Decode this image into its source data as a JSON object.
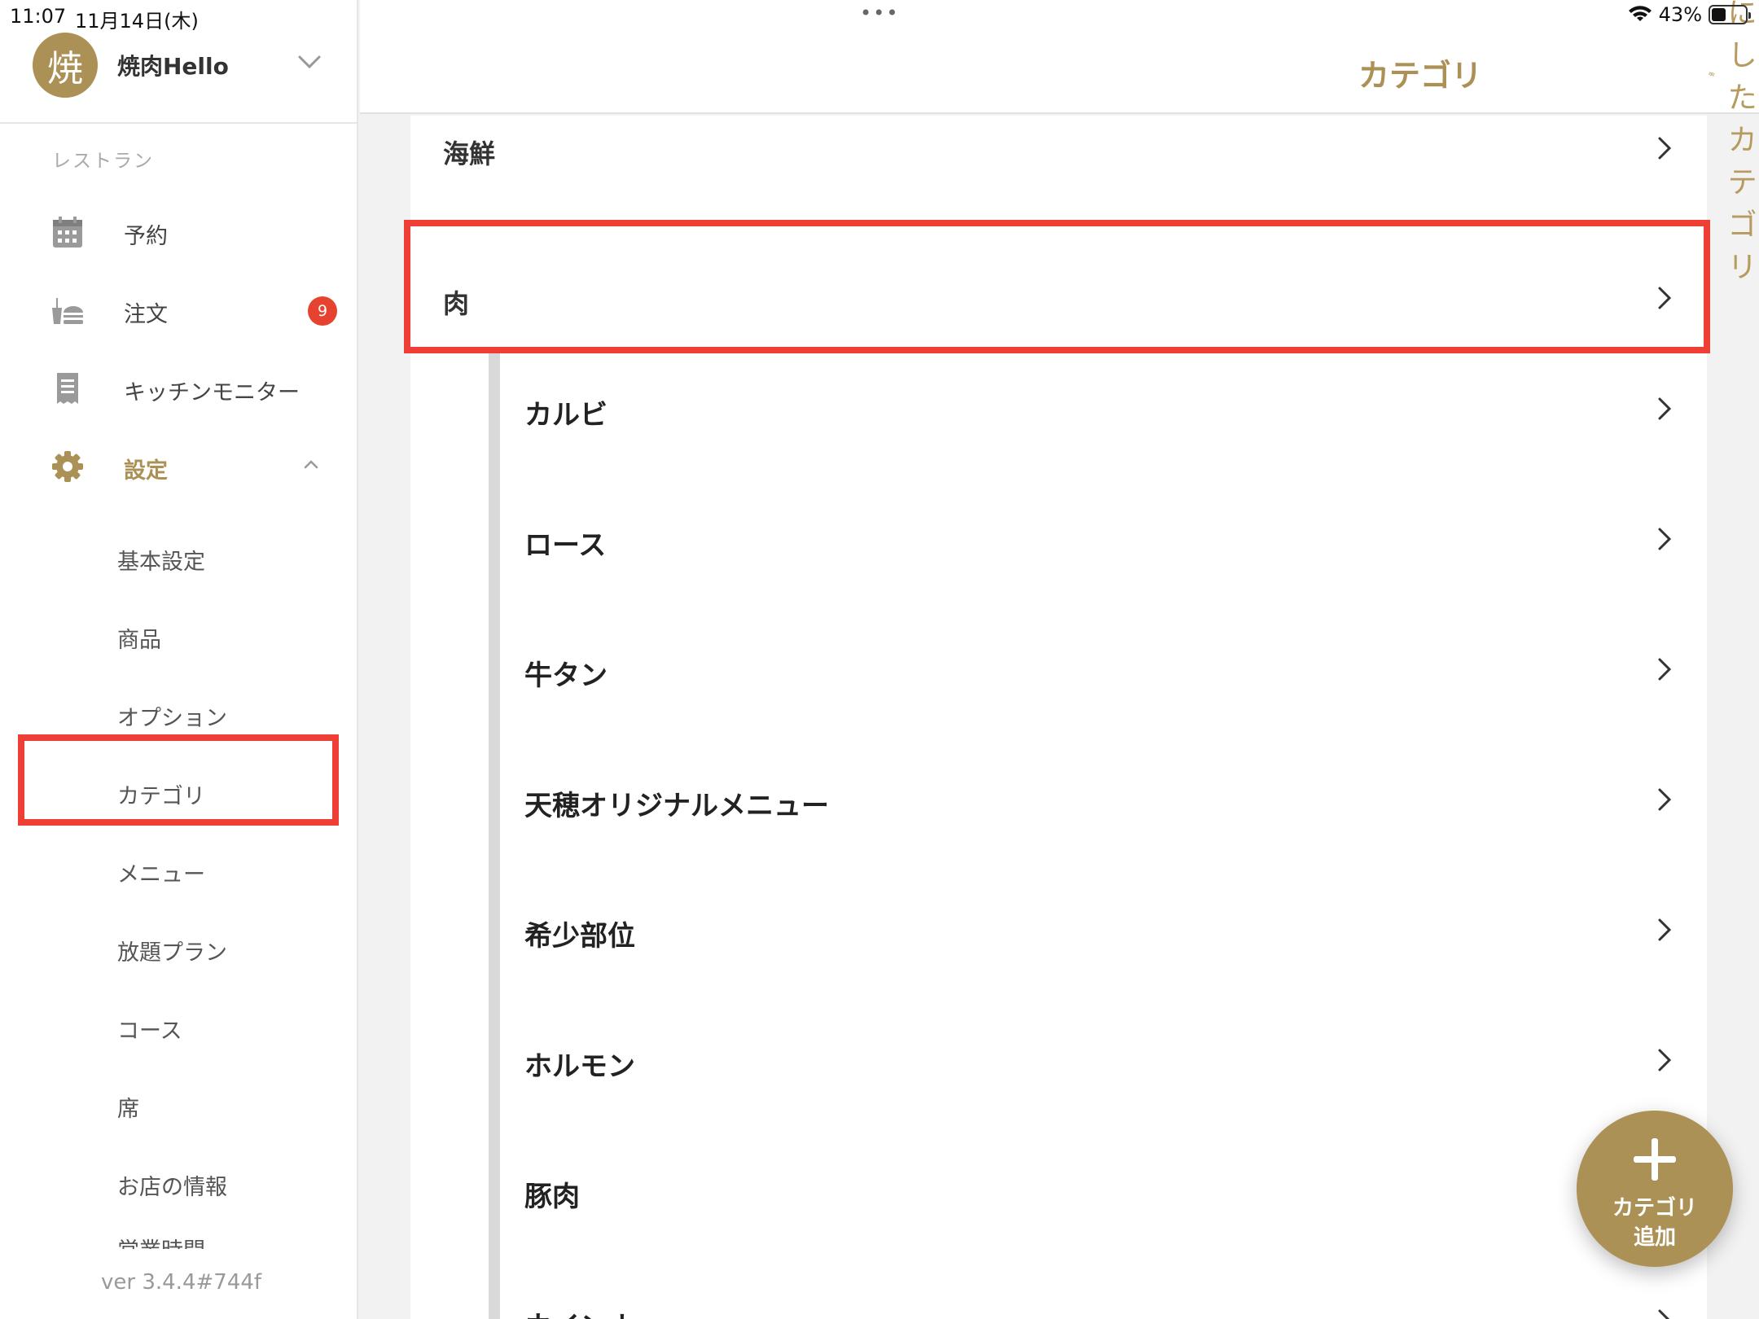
{
  "status_bar": {
    "time": "11:07",
    "date": "11月14日(木)",
    "dots": "•••",
    "battery_percent": "43%",
    "battery_level": 0.43
  },
  "account": {
    "avatar_char": "焼",
    "name": "焼肉Hello"
  },
  "sidebar": {
    "section_label": "レストラン",
    "items": [
      {
        "label": "予約",
        "icon": "calendar-icon"
      },
      {
        "label": "注文",
        "icon": "order-icon",
        "badge": "9"
      },
      {
        "label": "キッチンモニター",
        "icon": "receipt-icon"
      },
      {
        "label": "設定",
        "icon": "gear-icon"
      }
    ],
    "sub_items": [
      {
        "label": "基本設定"
      },
      {
        "label": "商品"
      },
      {
        "label": "オプション"
      },
      {
        "label": "カテゴリ"
      },
      {
        "label": "メニュー"
      },
      {
        "label": "放題プラン"
      },
      {
        "label": "コース"
      },
      {
        "label": "席"
      },
      {
        "label": "お店の情報"
      },
      {
        "label": "営業時間"
      }
    ],
    "version": "ver 3.4.4#744f"
  },
  "header": {
    "title": "カテゴリ",
    "hidden_categories_label": "非表示にしたカテゴリ"
  },
  "categories": {
    "top": [
      {
        "label": "海鮮"
      },
      {
        "label": "肉"
      }
    ],
    "children": [
      {
        "label": "カルビ"
      },
      {
        "label": "ロース"
      },
      {
        "label": "牛タン"
      },
      {
        "label": "天穂オリジナルメニュー"
      },
      {
        "label": "希少部位"
      },
      {
        "label": "ホルモン"
      },
      {
        "label": "豚肉"
      },
      {
        "label": "ウインナ"
      }
    ]
  },
  "fab": {
    "line1": "カテゴリ",
    "line2": "追加"
  },
  "colors": {
    "accent": "#ab9155",
    "badge": "#e5432f",
    "highlight": "#ef3e36"
  }
}
